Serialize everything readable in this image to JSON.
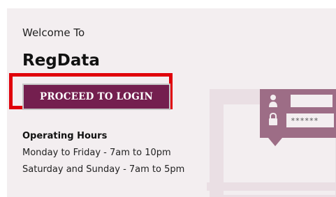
{
  "welcome": {
    "greeting": "Welcome To",
    "brand": "RegData"
  },
  "login": {
    "button_label": "PROCEED TO LOGIN"
  },
  "hours": {
    "title": "Operating Hours",
    "lines": [
      "Monday to Friday - 7am to 10pm",
      "Saturday and Sunday - 7am to 5pm"
    ]
  },
  "illustration": {
    "password_mask": "******",
    "icons": [
      "user-icon",
      "lock-icon"
    ]
  },
  "colors": {
    "panel_bg": "#f3eef0",
    "button_bg": "#741f4f",
    "highlight": "#e0000b",
    "illustration_card": "#9d6d86"
  }
}
